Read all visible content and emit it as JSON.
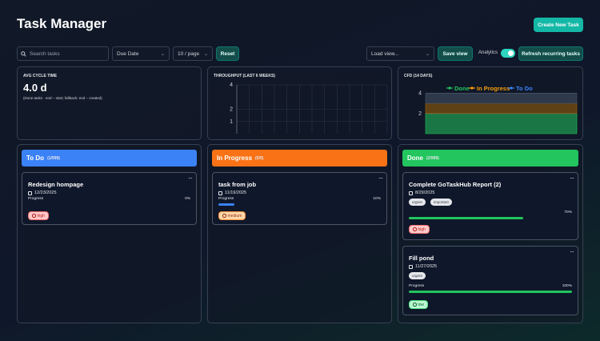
{
  "app": {
    "title": "Task Manager",
    "create_label": "Create New Task"
  },
  "toolbar": {
    "search_placeholder": "Search tasks",
    "sort_value": "Due Date",
    "page_size_value": "10 / page",
    "reset_label": "Reset",
    "view_select_value": "Load view...",
    "save_view_label": "Save view",
    "analytics_label": "Analytics",
    "analytics_on": true,
    "refresh_label": "Refresh recurring tasks"
  },
  "metrics": {
    "cycle": {
      "label": "AVG CYCLE TIME",
      "value": "4.0 d",
      "note": "(Done tasks · end − start; fallback: end − created)"
    },
    "throughput": {
      "label": "THROUGHPUT (LAST 6 WEEKS)"
    },
    "cfd": {
      "label": "CFD (14 DAYS)"
    }
  },
  "chart_data": [
    {
      "type": "line",
      "title": "THROUGHPUT (LAST 6 WEEKS)",
      "yticks": [
        "4",
        "2",
        "1"
      ],
      "ylim": [
        0,
        4
      ],
      "series": [],
      "grid": true
    },
    {
      "type": "area",
      "title": "CFD (14 DAYS)",
      "legend": [
        "Done",
        "In Progress",
        "To Do"
      ],
      "legend_colors": [
        "#22c55e",
        "#f59e0b",
        "#3b82f6"
      ],
      "legend_position": "top",
      "yticks": [
        "4",
        "2"
      ],
      "ylim": [
        0,
        4.6
      ],
      "series": [
        {
          "name": "Done",
          "values": [
            2,
            2,
            2,
            2,
            2,
            2,
            2,
            2,
            2,
            2,
            2,
            2,
            2,
            2
          ]
        },
        {
          "name": "In Progress",
          "values": [
            1,
            1,
            1,
            1,
            1,
            1,
            1,
            1,
            1,
            1,
            1,
            1,
            1,
            1
          ]
        },
        {
          "name": "To Do",
          "values": [
            1,
            1,
            1,
            1,
            1,
            1,
            1,
            1,
            1,
            1,
            1,
            1,
            1,
            1
          ]
        }
      ]
    }
  ],
  "columns": {
    "todo": {
      "name": "To Do",
      "count": "(1/999)",
      "color": "#3b82f6"
    },
    "inprogress": {
      "name": "In Progress",
      "count": "(5/5)",
      "color": "#f97316"
    },
    "done": {
      "name": "Done",
      "count": "(2/999)",
      "color": "#22c55e"
    }
  },
  "tasks": {
    "t1": {
      "name": "Redesign hompage",
      "date": "12/23/2025",
      "progress_label": "Progress",
      "progress": "0%",
      "progress_value": 0,
      "priority": "high"
    },
    "t2": {
      "name": "task from job",
      "date": "11/19/2025",
      "progress_label": "Progress",
      "progress": "10%",
      "progress_value": 0.1,
      "priority": "medium"
    },
    "t3": {
      "name": "Complete GoTaskHub Report (2)",
      "date": "8/29/2025",
      "tags": [
        "urgent",
        "important"
      ],
      "progress_label": "Progress",
      "progress": "70%",
      "progress_value": 0.7,
      "priority": "high"
    },
    "t4": {
      "name": "Fill pond",
      "date": "11/27/2025",
      "tags": [
        "urgent"
      ],
      "progress_label": "Progress",
      "progress": "100%",
      "progress_value": 1.0,
      "priority": "low"
    }
  },
  "menu_glyph": "···"
}
